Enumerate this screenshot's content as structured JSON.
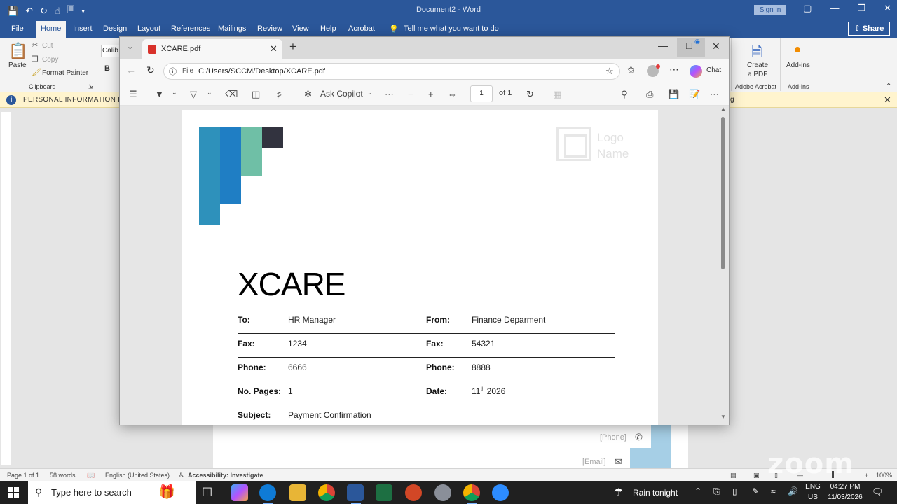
{
  "word": {
    "title": "Document2  -  Word",
    "signin": "Sign in",
    "share": "Share",
    "tabs": [
      "File",
      "Home",
      "Insert",
      "Design",
      "Layout",
      "References",
      "Mailings",
      "Review",
      "View",
      "Help",
      "Acrobat"
    ],
    "tell_me": "Tell me what you want to do",
    "ribbon": {
      "cut": "Cut",
      "copy": "Copy",
      "format_painter": "Format Painter",
      "paste": "Paste",
      "clipboard": "Clipboard",
      "font_name": "Calib",
      "create_pdf_line1": "Create",
      "create_pdf_line2": "a PDF",
      "adobe_group": "Adobe Acrobat",
      "addins": "Add-ins",
      "addins_group": "Add-ins",
      "bold": "B"
    },
    "info_bar": "PERSONAL INFORMATION RE",
    "info_tail": "g",
    "page_footer": {
      "phone": "[Phone]",
      "email": "[Email]"
    },
    "status": {
      "page": "Page 1 of 1",
      "words": "58 words",
      "language": "English (United States)",
      "accessibility": "Accessibility: Investigate",
      "zoom": "100%"
    },
    "watermark": "zoom"
  },
  "edge": {
    "tab_title": "XCARE.pdf",
    "address_label": "File",
    "url": "C:/Users/SCCM/Desktop/XCARE.pdf",
    "chat": "Chat",
    "ask_copilot": "Ask Copilot",
    "page_current": "1",
    "page_total": "of 1"
  },
  "pdf": {
    "logo_line1": "Logo",
    "logo_line2": "Name",
    "heading": "XCARE",
    "fields": [
      {
        "label_left": "To:",
        "value_left": "HR Manager",
        "label_right": "From:",
        "value_right": "Finance Deparment"
      },
      {
        "label_left": "Fax:",
        "value_left": "1234",
        "label_right": "Fax:",
        "value_right": "54321"
      },
      {
        "label_left": "Phone:",
        "value_left": "6666",
        "label_right": "Phone:",
        "value_right": "8888"
      },
      {
        "label_left": "No. Pages:",
        "value_left": "1",
        "label_right": "Date:",
        "value_right_day": "11",
        "value_right_sup": "th",
        "value_right_year": " 2026"
      },
      {
        "label_left": "Subject:",
        "value_left": "Payment Confirmation"
      }
    ],
    "colors": {
      "bar1": "#2e91bb",
      "bar2": "#1f7ec4",
      "bar3": "#6fbfa6",
      "bar4": "#32333f"
    }
  },
  "taskbar": {
    "search_placeholder": "Type here to search",
    "weather": "Rain tonight",
    "lang1": "ENG",
    "lang2": "US",
    "time": "04:27 PM",
    "date": "11/03/2026"
  }
}
